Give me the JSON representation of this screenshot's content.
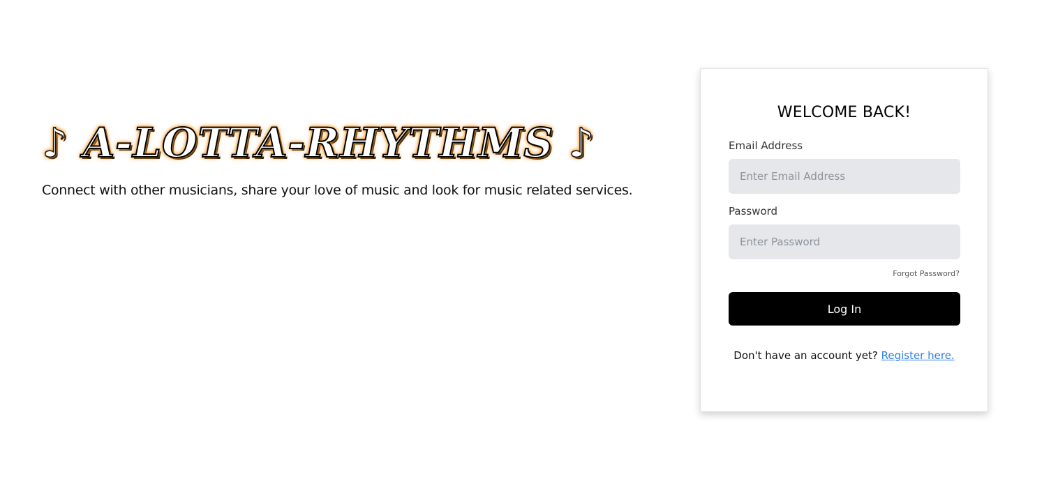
{
  "brand": {
    "note_glyph": "♪",
    "logo_text": "A-LOTTA-RHYTHMS",
    "tagline": "Connect with other musicians, share your love of music and look for music related services."
  },
  "login": {
    "title": "WELCOME BACK!",
    "email_label": "Email Address",
    "email_placeholder": "Enter Email Address",
    "email_value": "",
    "password_label": "Password",
    "password_placeholder": "Enter Password",
    "password_value": "",
    "forgot_label": "Forgot Password?",
    "submit_label": "Log In",
    "register_prompt": "Don't have an account yet?",
    "register_link": "Register here."
  },
  "colors": {
    "logo_glow": "#f59b2f",
    "button_bg": "#000000",
    "link": "#2f80ed",
    "input_bg": "#e5e7eb"
  }
}
